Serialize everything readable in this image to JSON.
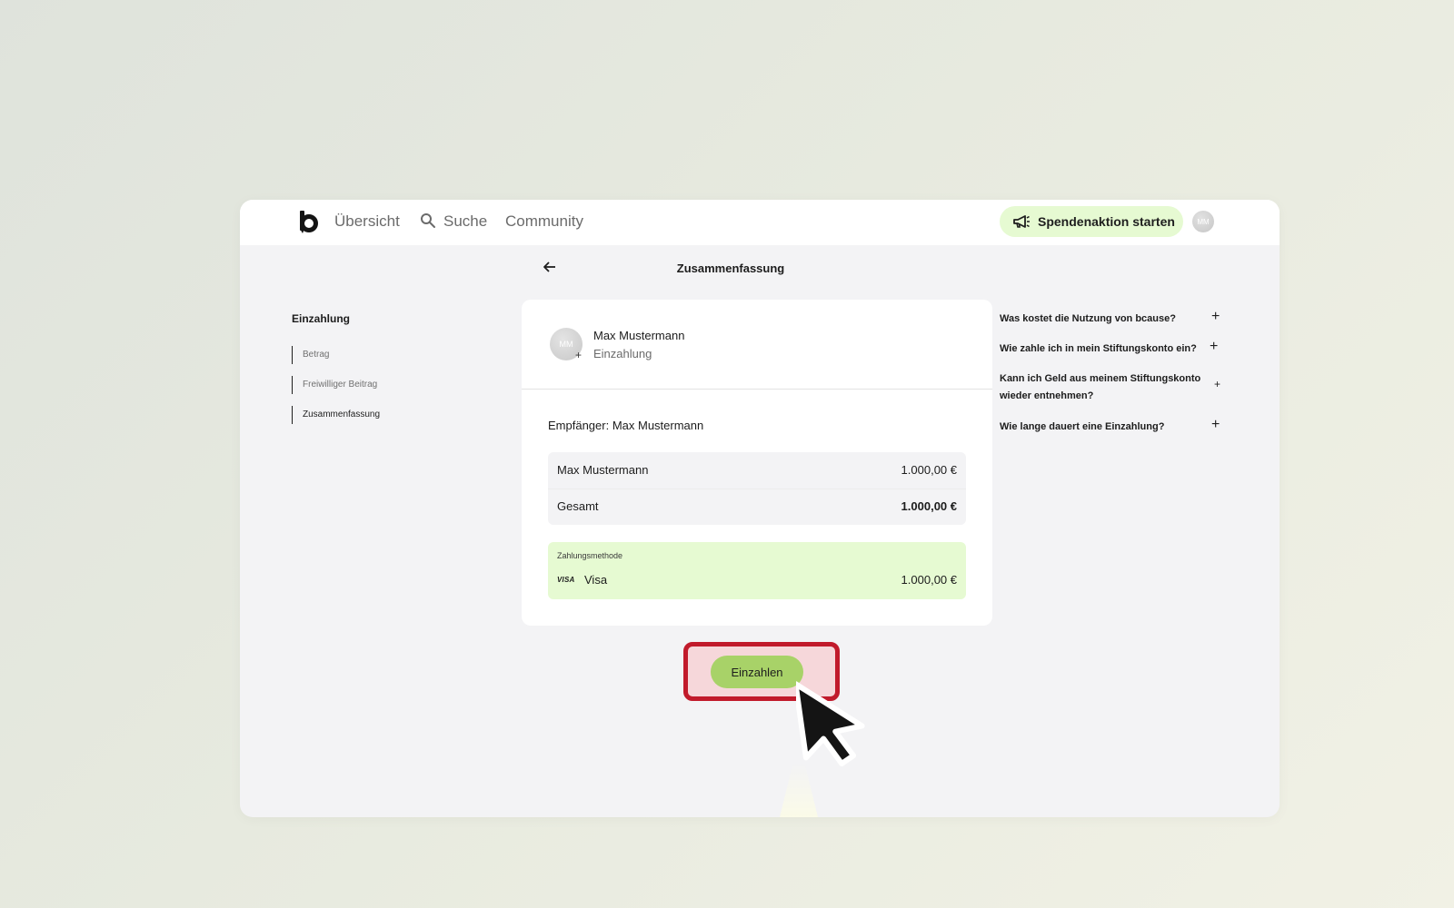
{
  "nav": {
    "overview": "Übersicht",
    "search": "Suche",
    "community": "Community",
    "cta_label": "Spendenaktion starten",
    "avatar_initials": "MM"
  },
  "header": {
    "title": "Zusammenfassung"
  },
  "steps": {
    "title": "Einzahlung",
    "items": [
      {
        "label": "Betrag"
      },
      {
        "label": "Freiwilliger Beitrag"
      },
      {
        "label": "Zusammenfassung",
        "active": true
      }
    ]
  },
  "card": {
    "avatar_initials": "MM",
    "name": "Max Mustermann",
    "subtitle": "Einzahlung",
    "recipient": "Empfänger: Max Mustermann",
    "rows": [
      {
        "label": "Max Mustermann",
        "value": "1.000,00 €"
      },
      {
        "label": "Gesamt",
        "value": "1.000,00 €",
        "bold": true
      }
    ],
    "payment": {
      "title": "Zahlungsmethode",
      "brand": "VISA",
      "method": "Visa",
      "amount": "1.000,00 €"
    }
  },
  "faq": [
    {
      "question": "Was kostet die Nutzung von bcause?"
    },
    {
      "question": "Wie zahle ich in mein Stiftungskonto ein?"
    },
    {
      "question": "Kann ich Geld aus meinem Stiftungskonto wieder entnehmen?"
    },
    {
      "question": "Wie lange dauert eine Einzahlung?"
    }
  ],
  "actions": {
    "submit_label": "Einzahlen"
  },
  "colors": {
    "accent_light": "#e6fad2",
    "button": "#a8d268",
    "highlight_border": "#c11a2b"
  },
  "icons": [
    "bcause-logo",
    "search-icon",
    "megaphone-icon",
    "back-arrow-icon",
    "visa-icon",
    "plus-icon",
    "mouse-cursor-icon"
  ]
}
